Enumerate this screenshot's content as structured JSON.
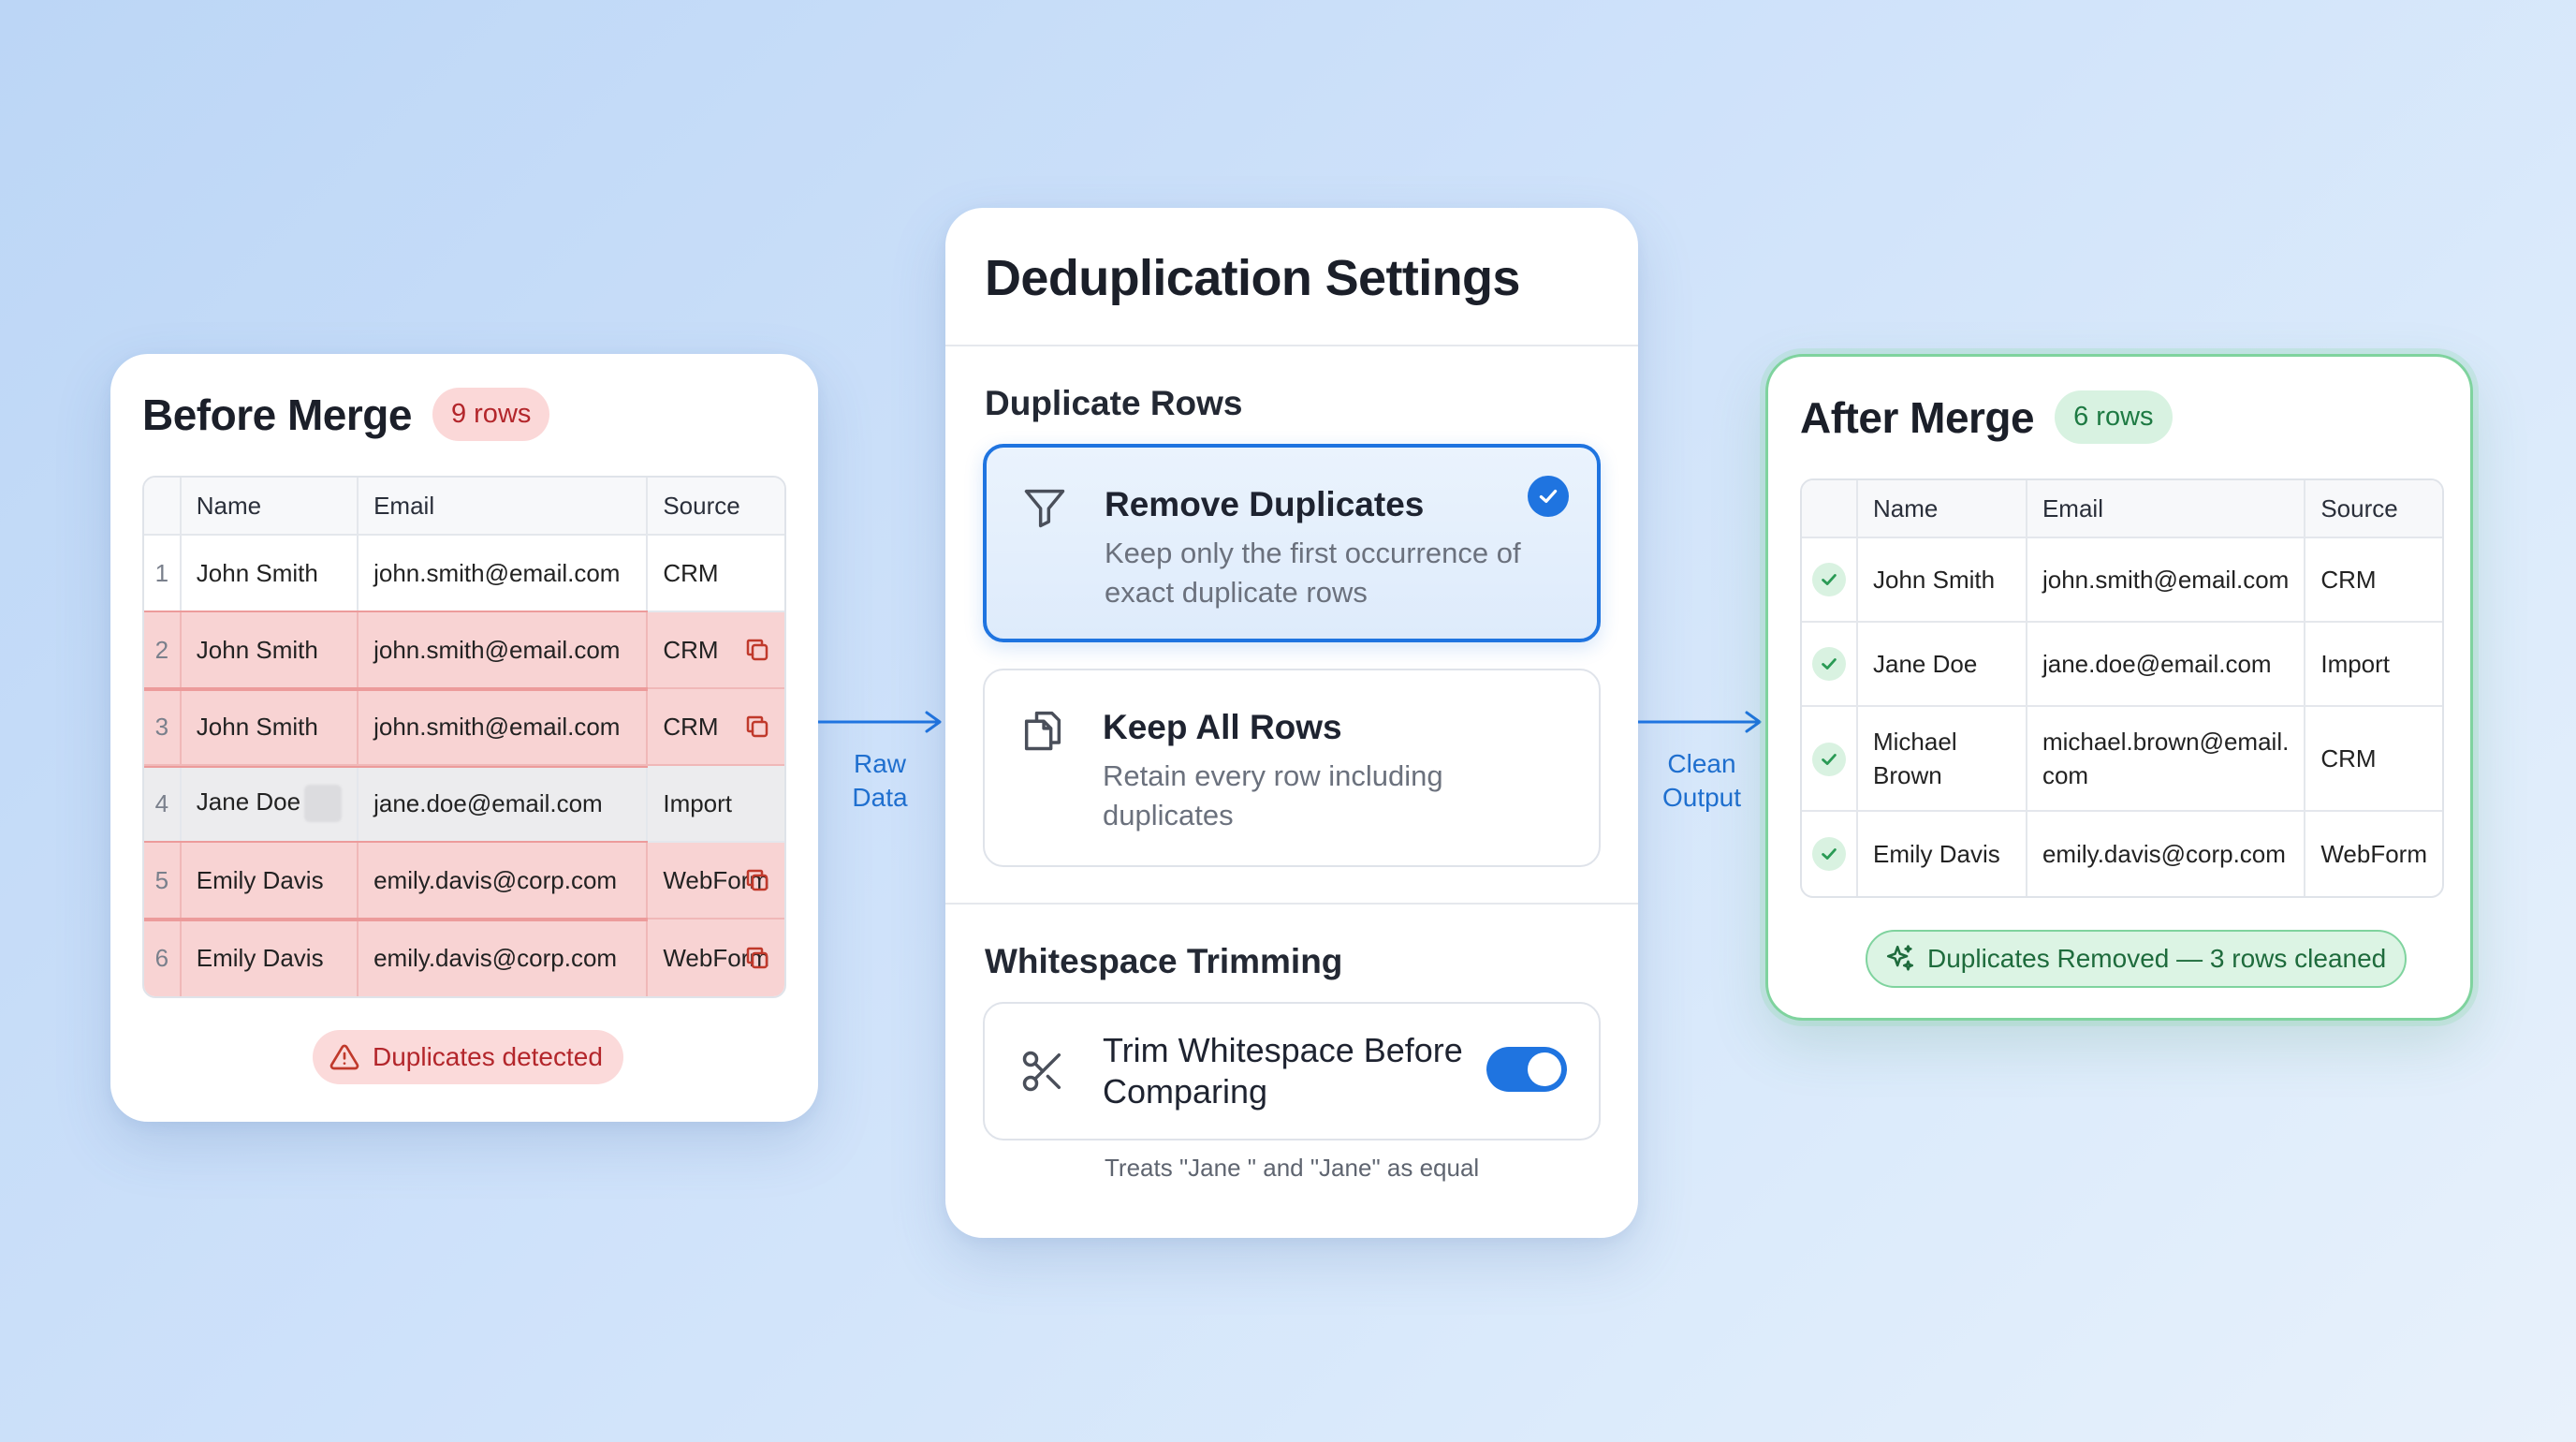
{
  "colors": {
    "accent": "#1f74e0",
    "danger": "#b3262b",
    "success": "#1e7a43"
  },
  "before": {
    "title": "Before Merge",
    "badge": "9 rows",
    "columns": [
      "Name",
      "Email",
      "Source"
    ],
    "rows": [
      {
        "index": "1",
        "name": "John Smith",
        "email": "john.smith@email.com",
        "source": "CRM",
        "status": "normal"
      },
      {
        "index": "2",
        "name": "John Smith",
        "email": "john.smith@email.com",
        "source": "CRM",
        "status": "duplicate"
      },
      {
        "index": "3",
        "name": "John Smith",
        "email": "john.smith@email.com",
        "source": "CRM",
        "status": "duplicate"
      },
      {
        "index": "4",
        "name": "Jane Doe",
        "email": "jane.doe@email.com",
        "source": "Import",
        "status": "whitespace"
      },
      {
        "index": "5",
        "name": "Emily Davis",
        "email": "emily.davis@corp.com",
        "source": "WebForm",
        "status": "duplicate"
      },
      {
        "index": "6",
        "name": "Emily Davis",
        "email": "emily.davis@corp.com",
        "source": "WebForm",
        "status": "duplicate"
      }
    ],
    "warning": "Duplicates detected",
    "warning_icon": "warning-triangle-icon",
    "duplicate_icon": "copy-icon"
  },
  "arrows": {
    "left_label_1": "Raw",
    "left_label_2": "Data",
    "right_label_1": "Clean",
    "right_label_2": "Output"
  },
  "settings": {
    "title": "Deduplication Settings",
    "duplicate_section": "Duplicate Rows",
    "options": [
      {
        "title": "Remove Duplicates",
        "description": "Keep only the first occurrence of exact duplicate rows",
        "icon": "filter-icon",
        "selected": true
      },
      {
        "title": "Keep All Rows",
        "description": "Retain every row including duplicates",
        "icon": "copy-icon",
        "selected": false
      }
    ],
    "whitespace_section": "Whitespace Trimming",
    "trim": {
      "label": "Trim Whitespace Before Comparing",
      "icon": "scissors-icon",
      "enabled": true
    },
    "footnote": "Treats \"Jane \" and \"Jane\" as equal"
  },
  "after": {
    "title": "After Merge",
    "badge": "6 rows",
    "columns": [
      "Name",
      "Email",
      "Source"
    ],
    "rows": [
      {
        "name": "John Smith",
        "email": "john.smith@email.com",
        "source": "CRM"
      },
      {
        "name": "Jane Doe",
        "email": "jane.doe@email.com",
        "source": "Import"
      },
      {
        "name": "Michael Brown",
        "email": "michael.brown@email.com",
        "source": "CRM"
      },
      {
        "name": "Emily Davis",
        "email": "emily.davis@corp.com",
        "source": "WebForm"
      }
    ],
    "row_icon": "check-icon",
    "success": "Duplicates Removed — 3 rows cleaned",
    "success_icon": "sparkle-icon"
  }
}
